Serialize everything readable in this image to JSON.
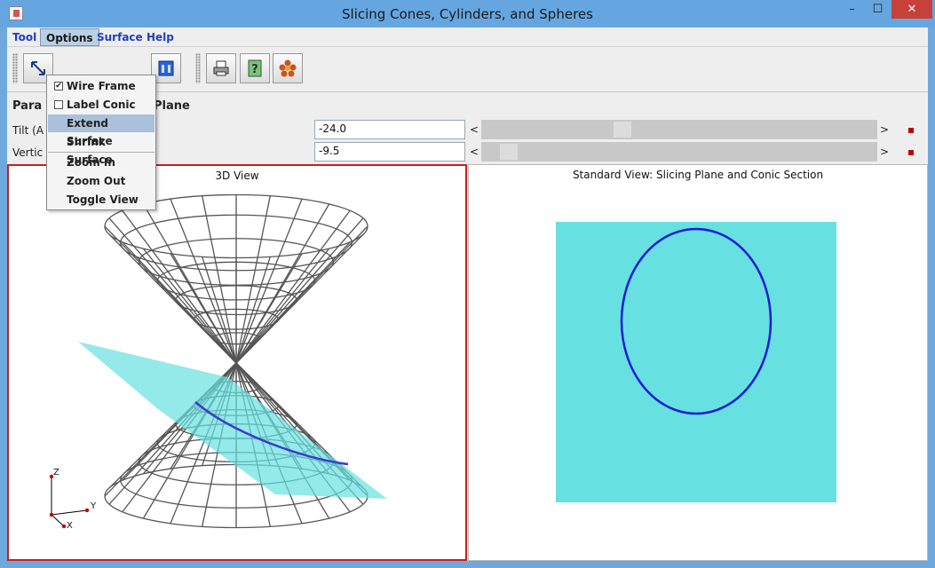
{
  "window": {
    "title": "Slicing Cones, Cylinders, and Spheres"
  },
  "window_controls": {
    "minimize": "–",
    "maximize": "☐",
    "close": "✕"
  },
  "menubar": [
    {
      "label": "Tool"
    },
    {
      "label": "Options"
    },
    {
      "label": "Surface"
    },
    {
      "label": "Help"
    }
  ],
  "options_menu": {
    "items": [
      {
        "label": "Wire Frame",
        "checked": true
      },
      {
        "label": "Label Conic",
        "checked": false
      },
      {
        "label": "Extend Surface",
        "highlighted": true
      },
      {
        "label": "Shrink Surface"
      },
      {
        "label": "Zoom In"
      },
      {
        "label": "Zoom Out"
      },
      {
        "label": "Toggle View"
      }
    ]
  },
  "toolbar": {
    "buttons": [
      {
        "icon": "expand-arrows-icon"
      },
      {
        "icon": "window-icon"
      },
      {
        "icon": "print-icon"
      },
      {
        "icon": "help-icon"
      },
      {
        "icon": "flower-icon"
      }
    ]
  },
  "params": {
    "heading_left": "Para",
    "heading_right": "Plane",
    "tilt": {
      "label": "Tilt (A",
      "value": "-24.0",
      "slider_fraction": 0.35
    },
    "vertical": {
      "label": "Vertic",
      "value": "-9.5",
      "slider_fraction": 0.05
    }
  },
  "view3d": {
    "caption": "3D View",
    "axes": {
      "z": "Z",
      "y": "Y",
      "x": "X"
    }
  },
  "view2d": {
    "caption": "Standard View: Slicing Plane and Conic Section"
  },
  "colors": {
    "plane": "#66e0e0",
    "conic": "#1a1ad6",
    "wire": "#555555",
    "view3d_border": "#c81e1e"
  }
}
